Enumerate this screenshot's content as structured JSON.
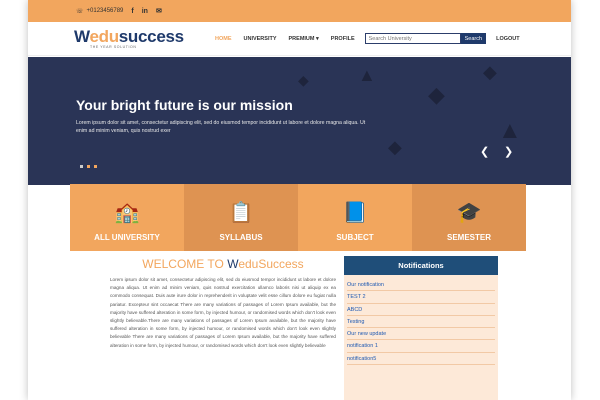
{
  "topbar": {
    "phone": "+0123456789",
    "icons": [
      "phone-icon",
      "facebook-icon",
      "linkedin-icon",
      "mail-icon"
    ]
  },
  "logo": {
    "prefix": "W",
    "accent": "edu",
    "suffix": "success",
    "tagline": "THE YEAR SOLUTION"
  },
  "nav": {
    "items": [
      "HOME",
      "UNIVERSITY",
      "PREMIUM",
      "PROFILE"
    ],
    "active": "HOME",
    "search_placeholder": "Search University",
    "search_button": "Search",
    "logout": "LOGOUT"
  },
  "hero": {
    "title": "Your bright future is our mission",
    "text": "Lorem ipsum dolor sit amet, consectetur adipiscing elit, sed do eiusmod tempor incididunt ut labore et dolore magna aliqua. Ut enim ad minim veniam, quis nostrud exer"
  },
  "cards": [
    "ALL UNIVERSITY",
    "SYLLABUS",
    "SUBJECT",
    "SEMESTER"
  ],
  "welcome": {
    "prefix": "WELCOME TO ",
    "brand_w": "W",
    "brand_rest": "eduSuccess",
    "text": "Lorem ipsum dolor sit amet, consectetur adipiscing elit, sed do eiusmod tempor incididunt ut labore et dolore magna aliqua. Ut enim ad minim veniam, quis nostrud exercitation ullamco laboris nisi ut aliquip ex ea commodo consequat. Duis aute irure dolor in reprehenderit in voluptate velit esse cillum dolore eu fugiat nulla pariatur. Excepteur sint occaecat There are many variations of passages of Lorem Ipsum available, but the majority have suffered alteration in some form, by injected humour, or randomised words which don't look even slightly believable.There are many variations of passages of Lorem Ipsum available, but the majority have suffered alteration in some form, by injected humour, or randomised words which don't look even slightly believable There are many variations of passages of Lorem Ipsum available, but the majority have suffered alteration in some form, by injected humour, or randomised words which don't look even slightly believable"
  },
  "notifications": {
    "title": "Notifications",
    "items": [
      "Our notification",
      "TEST 2",
      "ABCD",
      "Testing",
      "Our new update",
      "notification 1",
      "notification5"
    ]
  },
  "colors": {
    "accent": "#f2a65e",
    "brand": "#1f3a6b",
    "hero_bg": "#2a3456"
  }
}
